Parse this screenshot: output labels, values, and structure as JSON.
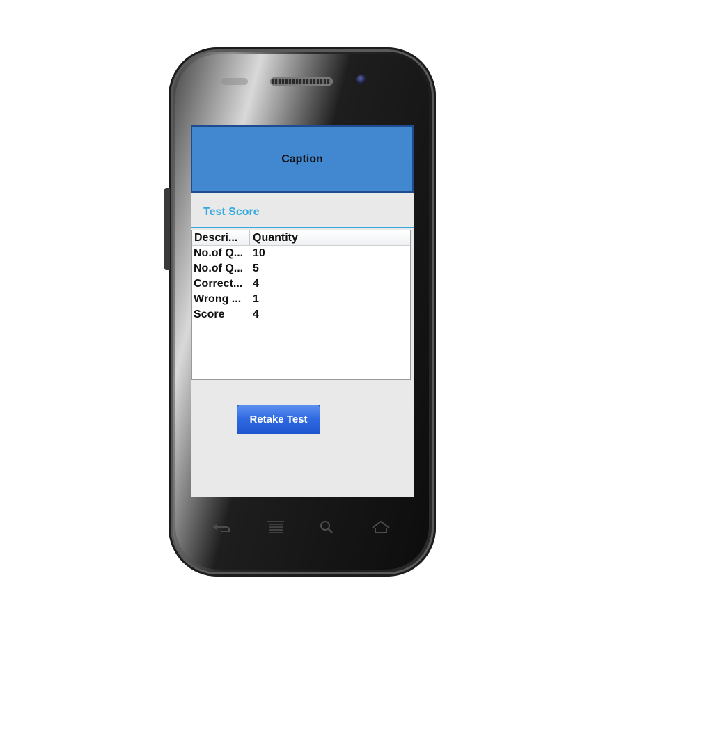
{
  "header": {
    "caption": "Caption"
  },
  "section": {
    "title": "Test Score"
  },
  "table": {
    "columns": [
      "Descri...",
      "Quantity"
    ],
    "rows": [
      {
        "description": "No.of Q...",
        "quantity": "10"
      },
      {
        "description": "No.of Q...",
        "quantity": "5"
      },
      {
        "description": "Correct...",
        "quantity": "4"
      },
      {
        "description": "Wrong ...",
        "quantity": "1"
      },
      {
        "description": "Score",
        "quantity": "4"
      }
    ]
  },
  "actions": {
    "retake_label": "Retake Test"
  },
  "device_keys": {
    "back": "back-icon",
    "menu": "menu-icon",
    "search": "search-icon",
    "home": "home-icon"
  },
  "colors": {
    "caption_bg": "#4188d0",
    "section_title": "#36a9df",
    "button_bg": "#2e68e0"
  }
}
